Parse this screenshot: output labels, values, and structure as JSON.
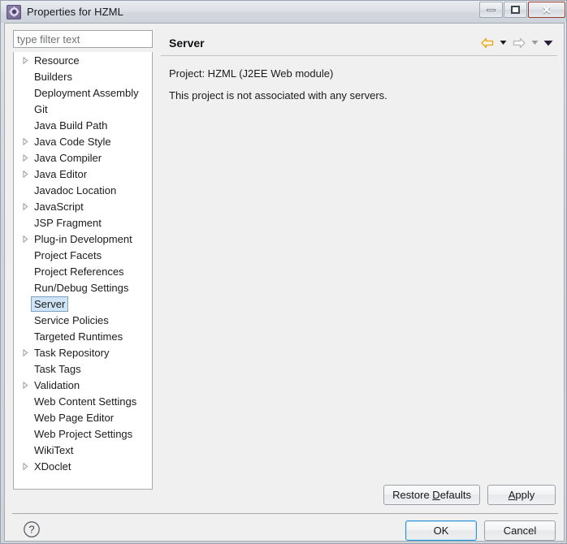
{
  "window": {
    "title": "Properties for HZML",
    "icon": "gear-icon",
    "controls": {
      "minimize": "minimize-icon",
      "maximize": "maximize-icon",
      "close": "✕"
    }
  },
  "filter": {
    "placeholder": "type filter text",
    "value": ""
  },
  "tree": {
    "items": [
      {
        "label": "Resource",
        "expandable": true,
        "selected": false
      },
      {
        "label": "Builders",
        "expandable": false,
        "selected": false
      },
      {
        "label": "Deployment Assembly",
        "expandable": false,
        "selected": false
      },
      {
        "label": "Git",
        "expandable": false,
        "selected": false
      },
      {
        "label": "Java Build Path",
        "expandable": false,
        "selected": false
      },
      {
        "label": "Java Code Style",
        "expandable": true,
        "selected": false
      },
      {
        "label": "Java Compiler",
        "expandable": true,
        "selected": false
      },
      {
        "label": "Java Editor",
        "expandable": true,
        "selected": false
      },
      {
        "label": "Javadoc Location",
        "expandable": false,
        "selected": false
      },
      {
        "label": "JavaScript",
        "expandable": true,
        "selected": false
      },
      {
        "label": "JSP Fragment",
        "expandable": false,
        "selected": false
      },
      {
        "label": "Plug-in Development",
        "expandable": true,
        "selected": false
      },
      {
        "label": "Project Facets",
        "expandable": false,
        "selected": false
      },
      {
        "label": "Project References",
        "expandable": false,
        "selected": false
      },
      {
        "label": "Run/Debug Settings",
        "expandable": false,
        "selected": false
      },
      {
        "label": "Server",
        "expandable": false,
        "selected": true
      },
      {
        "label": "Service Policies",
        "expandable": false,
        "selected": false
      },
      {
        "label": "Targeted Runtimes",
        "expandable": false,
        "selected": false
      },
      {
        "label": "Task Repository",
        "expandable": true,
        "selected": false
      },
      {
        "label": "Task Tags",
        "expandable": false,
        "selected": false
      },
      {
        "label": "Validation",
        "expandable": true,
        "selected": false
      },
      {
        "label": "Web Content Settings",
        "expandable": false,
        "selected": false
      },
      {
        "label": "Web Page Editor",
        "expandable": false,
        "selected": false
      },
      {
        "label": "Web Project Settings",
        "expandable": false,
        "selected": false
      },
      {
        "label": "WikiText",
        "expandable": false,
        "selected": false
      },
      {
        "label": "XDoclet",
        "expandable": true,
        "selected": false
      }
    ]
  },
  "pane": {
    "title": "Server",
    "lines": [
      "Project: HZML (J2EE Web module)",
      "This project is not associated with any servers."
    ],
    "nav": {
      "back": "back-arrow-icon",
      "back_menu": "back-dropdown-icon",
      "forward": "forward-arrow-icon",
      "forward_menu": "forward-dropdown-icon",
      "menu": "view-menu-icon"
    }
  },
  "buttons": {
    "restore_defaults": "Restore Defaults",
    "restore_defaults_mnemonic": "D",
    "apply": "Apply",
    "apply_mnemonic": "A",
    "ok": "OK",
    "cancel": "Cancel",
    "help": "help-icon"
  },
  "colors": {
    "selection_fill": "#cfe4f7",
    "selection_border": "#7da2c4",
    "back_arrow": "#e8a317",
    "forward_arrow": "#b9b9b9",
    "default_focus": "#2c93d4",
    "pane_bg": "#f0f0f0",
    "tree_bg": "#ffffff"
  }
}
